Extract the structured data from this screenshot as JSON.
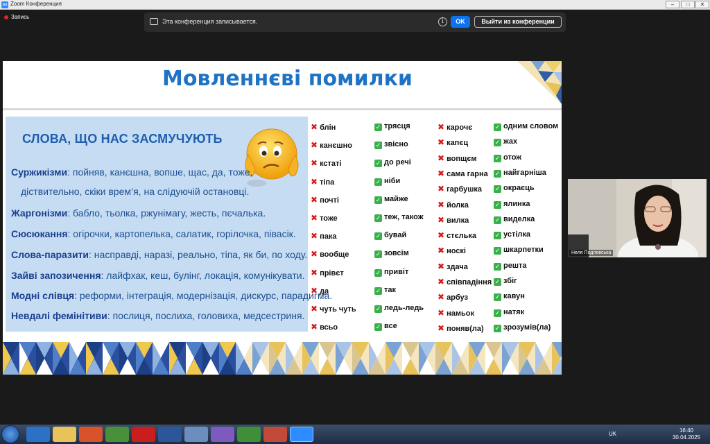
{
  "window": {
    "title": "Zoom Конференция",
    "app_icon": "zm"
  },
  "recording": {
    "label": "Запись"
  },
  "banner": {
    "message": "Эта конференция записывается.",
    "ok_label": "OK",
    "leave_label": "Выйти из конференции"
  },
  "slide": {
    "title": "Мовленнєві помилки",
    "box_heading": "СЛОВА, ЩО НАС ЗАСМУЧУЮТЬ",
    "categories": [
      {
        "name": "Суржикізми",
        "text": ": пойняв, канєшна, вопше, щас, да, тоже,"
      },
      {
        "name": "",
        "text": "діствительно, скіки врем’я, на слідуючій остановці."
      },
      {
        "name": "Жаргонізми",
        "text": ": бабло, тьолка, ржунімагу, жесть, пєчалька."
      },
      {
        "name": "Сюсюкання",
        "text": ": огірочки, картопелька, салатик, горілочка, півасік."
      },
      {
        "name": "Слова-паразити",
        "text": ": насправді, наразі, реально, тіпа, як би, по ходу."
      },
      {
        "name": "Зайві запозичення",
        "text": ": лайфхак, кеш, булінг, локація, комунікувати."
      },
      {
        "name": "Модні слівця",
        "text": ": реформи, інтеграція, модернізація, дискурс, парадигма."
      },
      {
        "name": "Невдалі фемінітиви",
        "text": ": послиця, послиха, головиха, медсестриня."
      }
    ],
    "col1_wrong": [
      "блін",
      "канєшно",
      "кстаті",
      "тіпа",
      "почті",
      "тоже",
      "пака",
      "вообще",
      "прівєт",
      "да",
      "чуть чуть",
      "всьо"
    ],
    "col1_right": [
      "трясця",
      "звісно",
      "до речі",
      "ніби",
      "майже",
      "теж, також",
      "бувай",
      "зовсім",
      "привіт",
      "так",
      "ледь-ледь",
      "все"
    ],
    "col2_wrong": [
      "карочє",
      "капєц",
      "вопщєм",
      "сама гарна",
      "гарбушка",
      "йолка",
      "вилка",
      "стєлька",
      "носкі",
      "здача",
      "співпадіння",
      "арбуз",
      "намьок",
      "поняв(ла)"
    ],
    "col2_right": [
      "одним словом",
      "жах",
      "отож",
      "найгарніша",
      "окраєць",
      "ялинка",
      "виделка",
      "устілка",
      "шкарпетки",
      "решта",
      "збіг",
      "кавун",
      "натяк",
      "зрозумів(ла)"
    ]
  },
  "participant": {
    "name": "Неля Подлевська"
  },
  "tray": {
    "lang": "UK",
    "time": "16:40",
    "date": "30.04.2025"
  },
  "colors": {
    "title_blue": "#1f73c4",
    "box_blue": "#c5dcf3",
    "wrong": "#d41a1a",
    "right": "#3ab04a",
    "zoom_blue": "#0e72ed"
  }
}
